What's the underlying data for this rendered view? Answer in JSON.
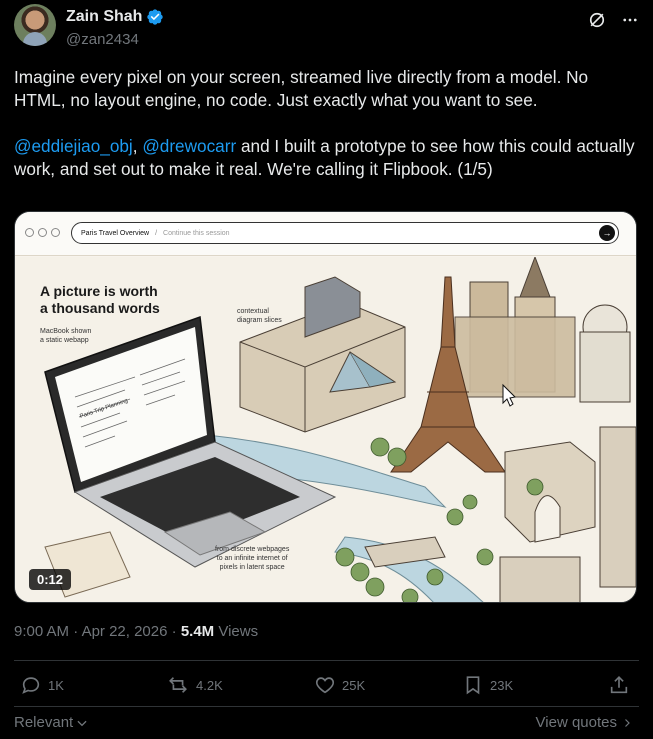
{
  "author": {
    "name": "Zain Shah",
    "handle": "@zan2434"
  },
  "tweet": {
    "paragraph1": "Imagine every pixel on your screen, streamed live directly from a model. No HTML, no layout engine, no code. Just exactly what you want to see.",
    "mention1": "@eddiejiao_obj",
    "sep": ", ",
    "mention2": "@drewocarr",
    "paragraph2_rest": " and I built a prototype to see how this could actually work, and set out to make it real. We're calling it Flipbook. (1/5)"
  },
  "media": {
    "url_title": "Paris Travel Overview",
    "url_placeholder": "Continue this session",
    "headline_line1": "A picture is worth",
    "headline_line2": "a thousand words",
    "note_macbook_1": "MacBook shown",
    "note_macbook_2": "a static webapp",
    "note_diagram_1": "contextual",
    "note_diagram_2": "diagram slices",
    "note_bottom_1": "from discrete webpages",
    "note_bottom_2": "to an infinite internet of",
    "note_bottom_3": "pixels in latent space",
    "laptop_screen_title": "Paris Trip Planning",
    "video_time": "0:12"
  },
  "meta": {
    "time": "9:00 AM",
    "dot": " · ",
    "date": "Apr 22, 2026",
    "views_count": "5.4M",
    "views_label": "Views"
  },
  "actions": {
    "replies": "1K",
    "reposts": "4.2K",
    "likes": "25K",
    "bookmarks": "23K"
  },
  "footer": {
    "relevant": "Relevant",
    "view_quotes": "View quotes"
  },
  "colors": {
    "background": "#000000",
    "text": "#e7e9ea",
    "muted": "#71767b",
    "accent": "#1d9bf0",
    "divider": "#2f3336"
  }
}
